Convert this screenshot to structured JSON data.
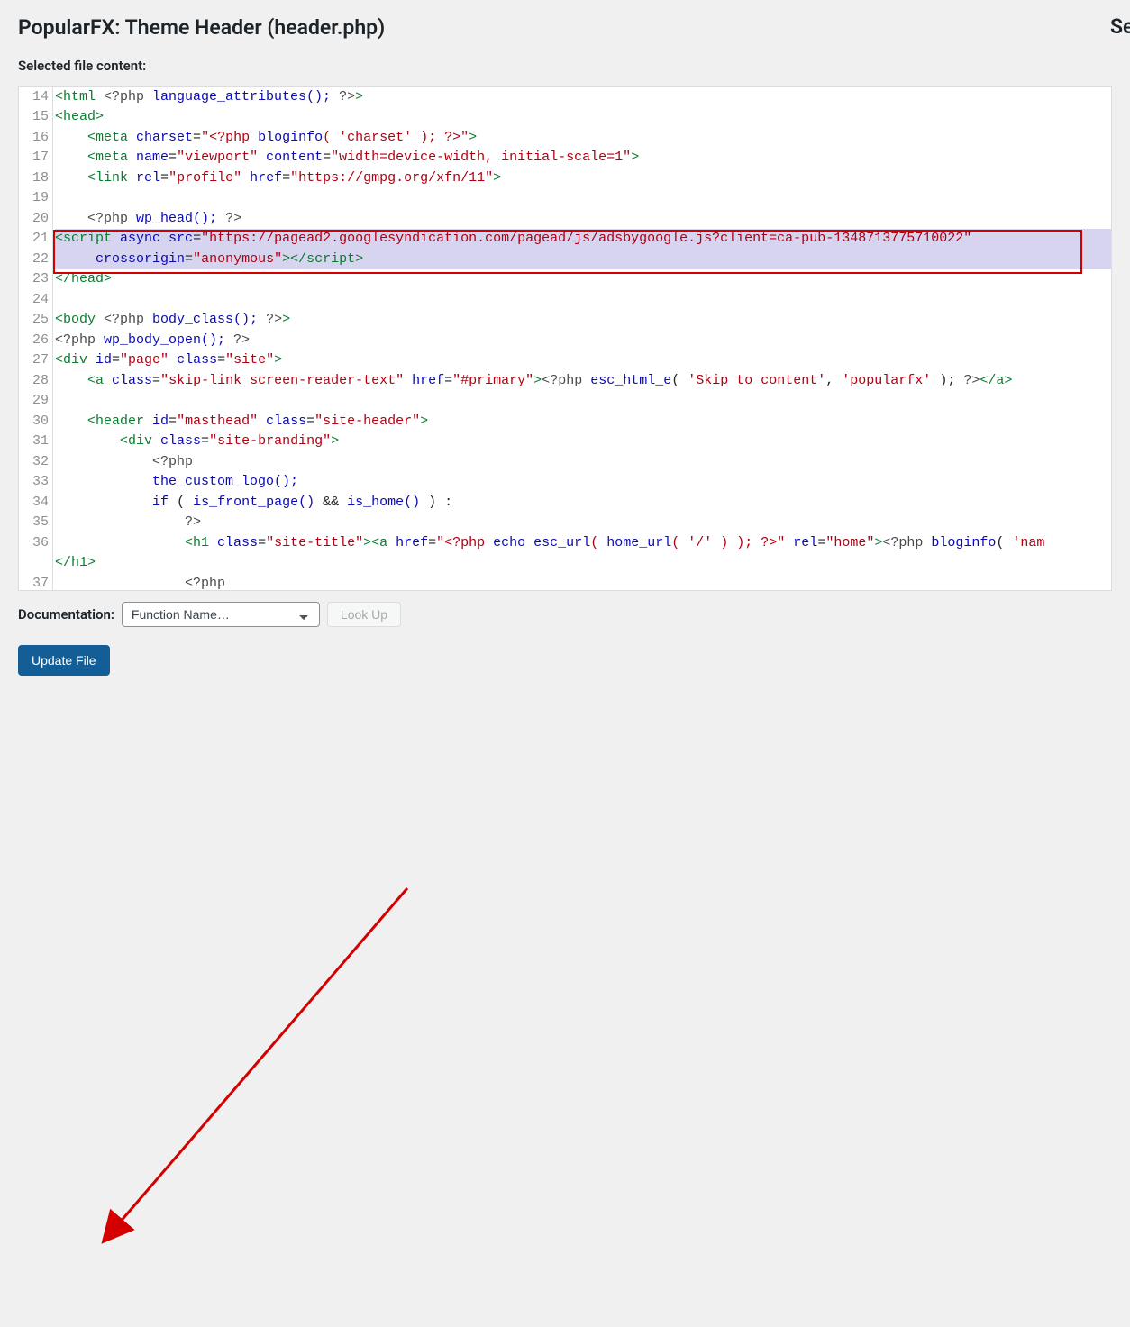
{
  "page_title": "PopularFX: Theme Header (header.php)",
  "right_edge_hint": "Se",
  "selected_label": "Selected file content:",
  "line_start": 14,
  "line_end": 37,
  "highlight_lines": [
    21,
    22
  ],
  "code_lines": [
    {
      "n": 14,
      "tokens": [
        [
          "t",
          "<html "
        ],
        [
          "phpd",
          "<?php "
        ],
        [
          "fn",
          "language_attributes(); "
        ],
        [
          "phpd",
          "?>"
        ],
        [
          "t",
          ">"
        ]
      ]
    },
    {
      "n": 15,
      "tokens": [
        [
          "t",
          "<head>"
        ]
      ]
    },
    {
      "n": 16,
      "tokens": [
        [
          "op",
          "    "
        ],
        [
          "t",
          "<meta "
        ],
        [
          "attr",
          "charset"
        ],
        [
          "op",
          "="
        ],
        [
          "str",
          "\"<?php "
        ],
        [
          "fn",
          "bloginfo"
        ],
        [
          "str",
          "( "
        ],
        [
          "str",
          "'charset'"
        ],
        [
          "str",
          " ); ?>\""
        ],
        [
          "t",
          ">"
        ]
      ]
    },
    {
      "n": 17,
      "tokens": [
        [
          "op",
          "    "
        ],
        [
          "t",
          "<meta "
        ],
        [
          "attr",
          "name"
        ],
        [
          "op",
          "="
        ],
        [
          "str",
          "\"viewport\""
        ],
        [
          "op",
          " "
        ],
        [
          "attr",
          "content"
        ],
        [
          "op",
          "="
        ],
        [
          "str",
          "\"width=device-width, initial-scale=1\""
        ],
        [
          "t",
          ">"
        ]
      ]
    },
    {
      "n": 18,
      "tokens": [
        [
          "op",
          "    "
        ],
        [
          "t",
          "<link "
        ],
        [
          "attr",
          "rel"
        ],
        [
          "op",
          "="
        ],
        [
          "str",
          "\"profile\""
        ],
        [
          "op",
          " "
        ],
        [
          "attr",
          "href"
        ],
        [
          "op",
          "="
        ],
        [
          "str",
          "\"https://gmpg.org/xfn/11\""
        ],
        [
          "t",
          ">"
        ]
      ]
    },
    {
      "n": 19,
      "tokens": []
    },
    {
      "n": 20,
      "tokens": [
        [
          "op",
          "    "
        ],
        [
          "phpd",
          "<?php "
        ],
        [
          "fn",
          "wp_head(); "
        ],
        [
          "phpd",
          "?>"
        ]
      ]
    },
    {
      "n": 21,
      "hl": true,
      "tokens": [
        [
          "t",
          "<script "
        ],
        [
          "attr",
          "async"
        ],
        [
          "op",
          " "
        ],
        [
          "attr",
          "src"
        ],
        [
          "op",
          "="
        ],
        [
          "str",
          "\"https://pagead2.googlesyndication.com/pagead/js/adsbygoogle.js?client=ca-pub-1348713775710022\""
        ]
      ]
    },
    {
      "n": 22,
      "hl": true,
      "tokens": [
        [
          "op",
          "     "
        ],
        [
          "attr",
          "crossorigin"
        ],
        [
          "op",
          "="
        ],
        [
          "str",
          "\"anonymous\""
        ],
        [
          "t",
          "></script>"
        ]
      ]
    },
    {
      "n": 23,
      "tokens": [
        [
          "t",
          "</head>"
        ]
      ]
    },
    {
      "n": 24,
      "tokens": []
    },
    {
      "n": 25,
      "tokens": [
        [
          "t",
          "<body "
        ],
        [
          "phpd",
          "<?php "
        ],
        [
          "fn",
          "body_class(); "
        ],
        [
          "phpd",
          "?>"
        ],
        [
          "t",
          ">"
        ]
      ]
    },
    {
      "n": 26,
      "tokens": [
        [
          "phpd",
          "<?php "
        ],
        [
          "fn",
          "wp_body_open(); "
        ],
        [
          "phpd",
          "?>"
        ]
      ]
    },
    {
      "n": 27,
      "tokens": [
        [
          "t",
          "<div "
        ],
        [
          "attr",
          "id"
        ],
        [
          "op",
          "="
        ],
        [
          "str",
          "\"page\""
        ],
        [
          "op",
          " "
        ],
        [
          "attr",
          "class"
        ],
        [
          "op",
          "="
        ],
        [
          "str",
          "\"site\""
        ],
        [
          "t",
          ">"
        ]
      ]
    },
    {
      "n": 28,
      "tokens": [
        [
          "op",
          "    "
        ],
        [
          "t",
          "<a "
        ],
        [
          "attr",
          "class"
        ],
        [
          "op",
          "="
        ],
        [
          "str",
          "\"skip-link screen-reader-text\""
        ],
        [
          "op",
          " "
        ],
        [
          "attr",
          "href"
        ],
        [
          "op",
          "="
        ],
        [
          "str",
          "\"#primary\""
        ],
        [
          "t",
          ">"
        ],
        [
          "phpd",
          "<?php "
        ],
        [
          "fn",
          "esc_html_e"
        ],
        [
          "op",
          "( "
        ],
        [
          "str",
          "'Skip to content'"
        ],
        [
          "op",
          ", "
        ],
        [
          "str",
          "'popularfx'"
        ],
        [
          "op",
          " ); "
        ],
        [
          "phpd",
          "?>"
        ],
        [
          "t",
          "</a>"
        ]
      ]
    },
    {
      "n": 29,
      "tokens": []
    },
    {
      "n": 30,
      "tokens": [
        [
          "op",
          "    "
        ],
        [
          "t",
          "<header "
        ],
        [
          "attr",
          "id"
        ],
        [
          "op",
          "="
        ],
        [
          "str",
          "\"masthead\""
        ],
        [
          "op",
          " "
        ],
        [
          "attr",
          "class"
        ],
        [
          "op",
          "="
        ],
        [
          "str",
          "\"site-header\""
        ],
        [
          "t",
          ">"
        ]
      ]
    },
    {
      "n": 31,
      "tokens": [
        [
          "op",
          "        "
        ],
        [
          "t",
          "<div "
        ],
        [
          "attr",
          "class"
        ],
        [
          "op",
          "="
        ],
        [
          "str",
          "\"site-branding\""
        ],
        [
          "t",
          ">"
        ]
      ]
    },
    {
      "n": 32,
      "tokens": [
        [
          "op",
          "            "
        ],
        [
          "phpd",
          "<?php"
        ]
      ]
    },
    {
      "n": 33,
      "tokens": [
        [
          "op",
          "            "
        ],
        [
          "fn",
          "the_custom_logo();"
        ]
      ]
    },
    {
      "n": 34,
      "tokens": [
        [
          "op",
          "            "
        ],
        [
          "fn",
          "if"
        ],
        [
          "op",
          " ( "
        ],
        [
          "fn",
          "is_front_page()"
        ],
        [
          "op",
          " && "
        ],
        [
          "fn",
          "is_home()"
        ],
        [
          "op",
          " ) :"
        ]
      ]
    },
    {
      "n": 35,
      "tokens": [
        [
          "op",
          "                "
        ],
        [
          "phpd",
          "?>"
        ]
      ]
    },
    {
      "n": 36,
      "tokens": [
        [
          "op",
          "                "
        ],
        [
          "t",
          "<h1 "
        ],
        [
          "attr",
          "class"
        ],
        [
          "op",
          "="
        ],
        [
          "str",
          "\"site-title\""
        ],
        [
          "t",
          "><a "
        ],
        [
          "attr",
          "href"
        ],
        [
          "op",
          "="
        ],
        [
          "str",
          "\"<?php "
        ],
        [
          "fn",
          "echo esc_url"
        ],
        [
          "str",
          "( "
        ],
        [
          "fn",
          "home_url"
        ],
        [
          "str",
          "( "
        ],
        [
          "str",
          "'/'"
        ],
        [
          "str",
          " ) ); ?>\""
        ],
        [
          "op",
          " "
        ],
        [
          "attr",
          "rel"
        ],
        [
          "op",
          "="
        ],
        [
          "str",
          "\"home\""
        ],
        [
          "t",
          ">"
        ],
        [
          "phpd",
          "<?php "
        ],
        [
          "fn",
          "bloginfo"
        ],
        [
          "op",
          "( "
        ],
        [
          "str",
          "'nam"
        ]
      ]
    },
    {
      "n": 36,
      "cont": true,
      "tokens": [
        [
          "t",
          "</h1>"
        ]
      ]
    },
    {
      "n": 37,
      "partial": true,
      "tokens": [
        [
          "op",
          "                "
        ],
        [
          "phpd",
          "<?php"
        ]
      ]
    }
  ],
  "documentation_label": "Documentation:",
  "documentation_placeholder": "Function Name…",
  "lookup_label": "Look Up",
  "update_button_label": "Update File"
}
